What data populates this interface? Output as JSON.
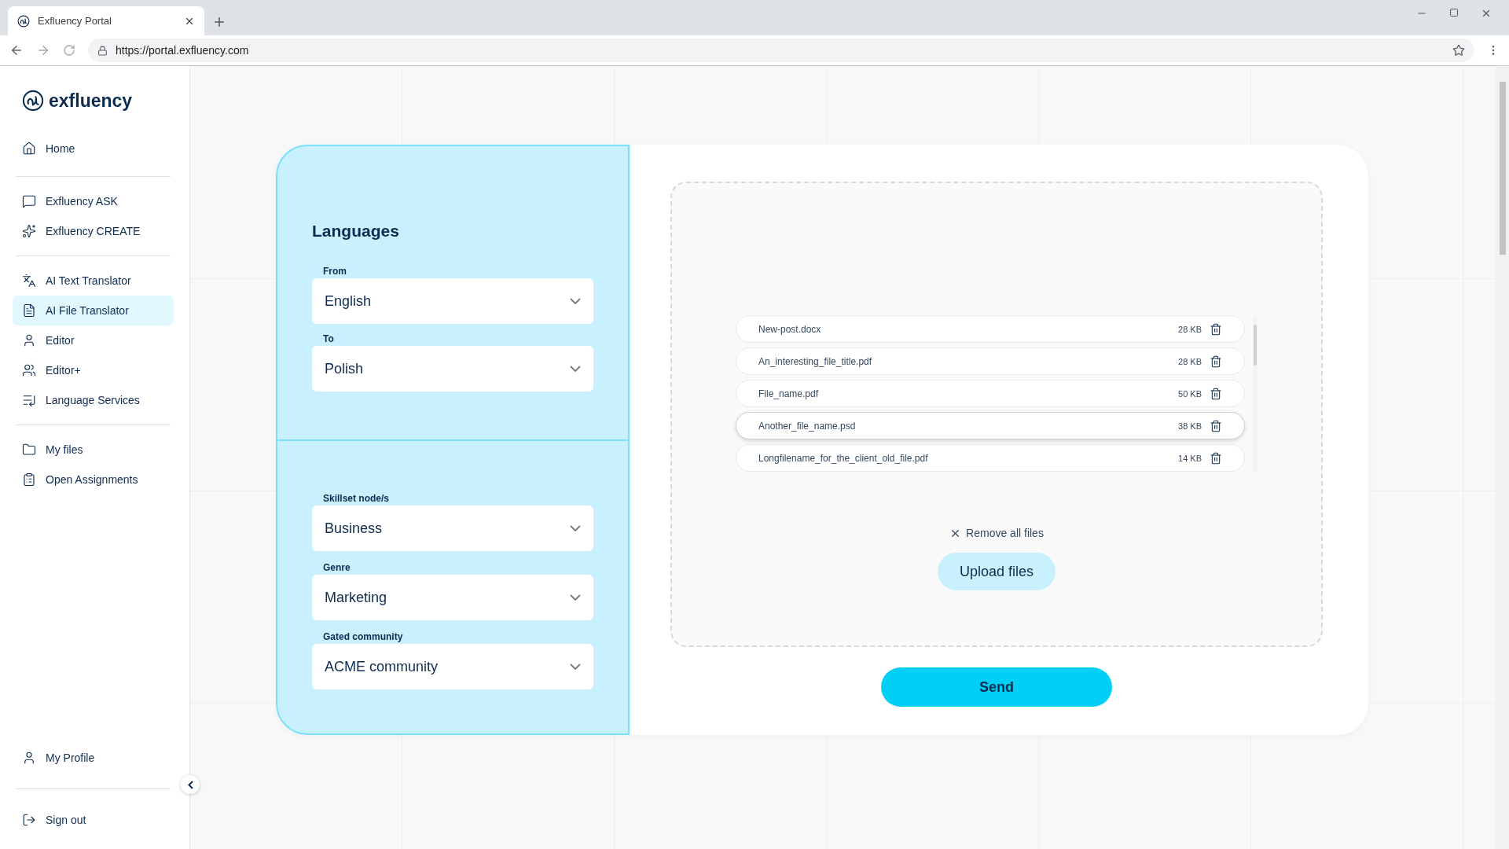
{
  "browser": {
    "tab_title": "Exfluency Portal",
    "url": "https://portal.exfluency.com"
  },
  "sidebar": {
    "logo_text": "exfluency",
    "groups": [
      [
        {
          "label": "Home",
          "selected": false
        }
      ],
      [
        {
          "label": "Exfluency ASK",
          "selected": false
        },
        {
          "label": "Exfluency CREATE",
          "selected": false
        }
      ],
      [
        {
          "label": "AI Text Translator",
          "selected": false
        },
        {
          "label": "AI File Translator",
          "selected": true
        },
        {
          "label": "Editor",
          "selected": false
        },
        {
          "label": "Editor+",
          "selected": false
        },
        {
          "label": "Language Services",
          "selected": false
        }
      ],
      [
        {
          "label": "My files",
          "selected": false
        },
        {
          "label": "Open Assignments",
          "selected": false
        }
      ]
    ],
    "footer": [
      {
        "label": "My Profile",
        "selected": false
      },
      {
        "label": "Sign out",
        "selected": false
      }
    ]
  },
  "languages": {
    "heading": "Languages",
    "fields": [
      {
        "label": "From",
        "value": "English"
      },
      {
        "label": "To",
        "value": "Polish"
      }
    ]
  },
  "settings": {
    "fields": [
      {
        "label": "Skillset node/s",
        "value": "Business"
      },
      {
        "label": "Genre",
        "value": "Marketing"
      },
      {
        "label": "Gated community",
        "value": "ACME community"
      }
    ]
  },
  "files": [
    {
      "name": "New-post.docx",
      "size": "28 KB",
      "highlighted": false
    },
    {
      "name": "An_interesting_file_title.pdf",
      "size": "28 KB",
      "highlighted": false
    },
    {
      "name": "File_name.pdf",
      "size": "50 KB",
      "highlighted": false
    },
    {
      "name": "Another_file_name.psd",
      "size": "38 KB",
      "highlighted": true
    },
    {
      "name": "Longfilename_for_the_client_old_file.pdf",
      "size": "14 KB",
      "highlighted": false
    }
  ],
  "remove_all": "Remove all files",
  "upload": "Upload files",
  "send": "Send"
}
